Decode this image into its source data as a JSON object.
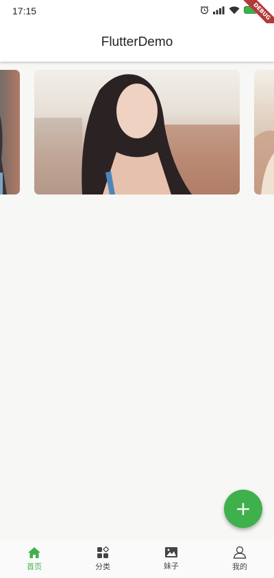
{
  "status_bar": {
    "time": "17:15",
    "icons": [
      "alarm-icon",
      "signal-icon",
      "wifi-icon",
      "battery-icon"
    ]
  },
  "app_bar": {
    "title": "FlutterDemo"
  },
  "debug_banner": {
    "label": "DEBUG"
  },
  "carousel": {
    "slides": [
      {
        "name": "previous-slide"
      },
      {
        "name": "current-slide"
      },
      {
        "name": "next-slide"
      }
    ]
  },
  "fab": {
    "label": "+",
    "color": "#3fb14c"
  },
  "bottom_nav": {
    "active_color": "#3fb14c",
    "items": [
      {
        "label": "首页",
        "icon": "home-icon",
        "active": true
      },
      {
        "label": "分类",
        "icon": "category-icon",
        "active": false
      },
      {
        "label": "妹子",
        "icon": "image-icon",
        "active": false
      },
      {
        "label": "我的",
        "icon": "person-icon",
        "active": false
      }
    ]
  }
}
